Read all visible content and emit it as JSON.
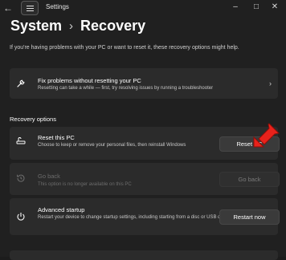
{
  "titlebar": {
    "app_title": "Settings",
    "back_icon": "back-arrow-icon",
    "menu_icon": "hamburger-menu-icon",
    "minimize": "–",
    "maximize": "□",
    "close": "✕"
  },
  "breadcrumb": {
    "parent": "System",
    "separator": "›",
    "current": "Recovery"
  },
  "intro_text": "If you're having problems with your PC or want to reset it, these recovery options might help.",
  "fix_card": {
    "icon": "wrench-icon",
    "title": "Fix problems without resetting your PC",
    "description": "Resetting can take a while — first, try resolving issues by running a troubleshooter",
    "chevron": "›"
  },
  "recovery_options": {
    "heading": "Recovery options",
    "items": [
      {
        "icon": "reset-pc-icon",
        "title": "Reset this PC",
        "description": "Choose to keep or remove your personal files, then reinstall Windows",
        "button": "Reset PC",
        "enabled": true
      },
      {
        "icon": "history-icon",
        "title": "Go back",
        "description": "This option is no longer available on this PC",
        "button": "Go back",
        "enabled": false
      },
      {
        "icon": "advanced-startup-icon",
        "title": "Advanced startup",
        "description": "Restart your device to change startup settings, including starting from a disc or USB drive",
        "button": "Restart now",
        "enabled": true
      }
    ]
  },
  "colors": {
    "background": "#202020",
    "card": "#2b2b2b",
    "annotation_arrow": "#e8221b"
  }
}
